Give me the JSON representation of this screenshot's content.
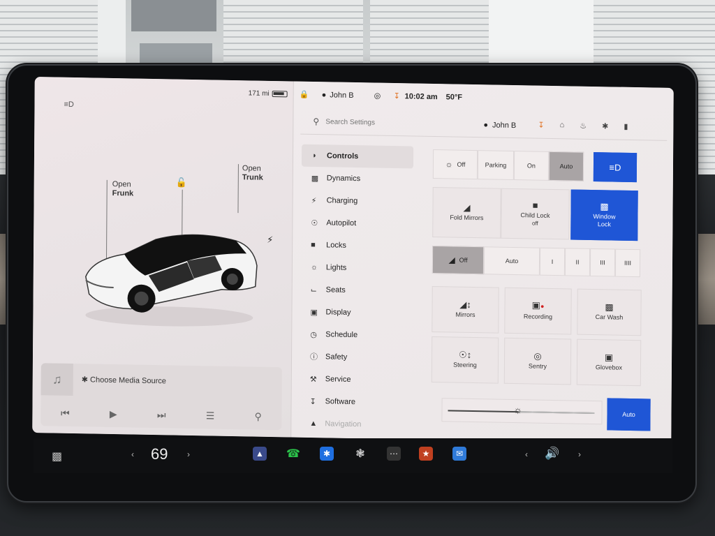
{
  "status": {
    "range": "171 mi",
    "user": "John B",
    "time": "10:02 am",
    "temp": "50°F"
  },
  "vehicle": {
    "frunk_label_1": "Open",
    "frunk_label_2": "Frunk",
    "trunk_label_1": "Open",
    "trunk_label_2": "Trunk"
  },
  "media": {
    "source_label": "Choose Media Source"
  },
  "search": {
    "placeholder": "Search Settings",
    "user": "John B"
  },
  "nav": [
    {
      "label": "Controls",
      "icon": "toggle-icon"
    },
    {
      "label": "Dynamics",
      "icon": "car-icon"
    },
    {
      "label": "Charging",
      "icon": "bolt-icon"
    },
    {
      "label": "Autopilot",
      "icon": "steering-icon"
    },
    {
      "label": "Locks",
      "icon": "lock-icon"
    },
    {
      "label": "Lights",
      "icon": "sun-icon"
    },
    {
      "label": "Seats",
      "icon": "seat-icon"
    },
    {
      "label": "Display",
      "icon": "display-icon"
    },
    {
      "label": "Schedule",
      "icon": "clock-icon"
    },
    {
      "label": "Safety",
      "icon": "alert-icon"
    },
    {
      "label": "Service",
      "icon": "wrench-icon"
    },
    {
      "label": "Software",
      "icon": "download-icon"
    },
    {
      "label": "Navigation",
      "icon": "navigation-icon"
    }
  ],
  "headlights": {
    "off": "Off",
    "parking": "Parking",
    "on": "On",
    "auto": "Auto",
    "selected": "Auto"
  },
  "controls_row1": {
    "fold_mirrors": "Fold Mirrors",
    "child_lock": "Child Lock",
    "child_lock_state": "off",
    "window_lock_1": "Window",
    "window_lock_2": "Lock"
  },
  "wipers": {
    "off": "Off",
    "auto": "Auto",
    "s1": "I",
    "s2": "II",
    "s3": "III",
    "s4": "IIII",
    "selected": "Off"
  },
  "tiles": {
    "mirrors": "Mirrors",
    "recording": "Recording",
    "car_wash": "Car Wash",
    "steering": "Steering",
    "sentry": "Sentry",
    "glovebox": "Glovebox"
  },
  "brightness": {
    "auto": "Auto",
    "level_fraction": 0.48
  },
  "taskbar": {
    "cabin_temp": "69"
  },
  "colors": {
    "accent_blue": "#1f56d6",
    "download_orange": "#e07020"
  }
}
